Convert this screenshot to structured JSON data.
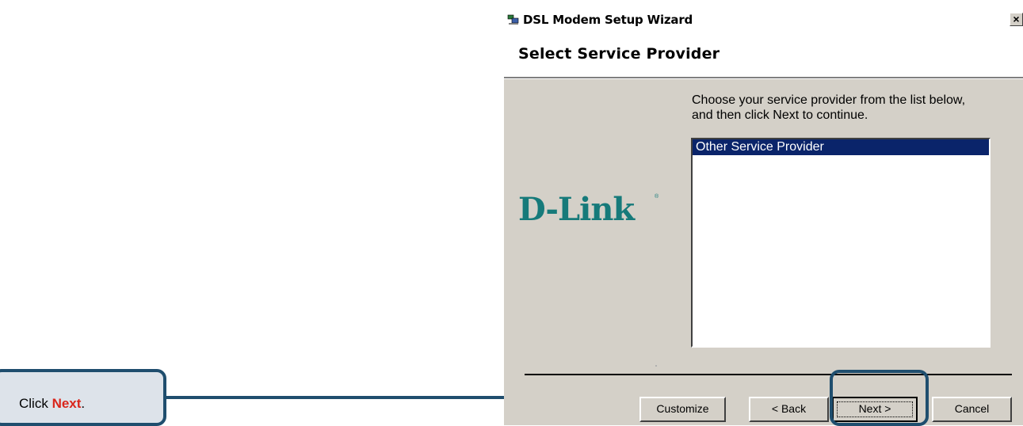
{
  "window": {
    "title": "DSL Modem Setup Wizard",
    "close_glyph": "×",
    "header_title": "Select Service Provider"
  },
  "logo": {
    "text": "D-Link",
    "mark": "®",
    "color": "#167a7a"
  },
  "content": {
    "instructions": "Choose your service provider from the list below, and then click Next to continue.",
    "providers": [
      "Other Service Provider"
    ],
    "selected_provider": "Other Service Provider"
  },
  "buttons": {
    "customize": "Customize",
    "back": "< Back",
    "next": "Next >",
    "cancel": "Cancel"
  },
  "callout": {
    "prefix": "Click ",
    "highlight": "Next",
    "suffix": ".",
    "highlight_color": "#d9261c",
    "frame_color": "#1f4e6e"
  },
  "icons": {
    "title_icon": "network-computers-icon"
  }
}
